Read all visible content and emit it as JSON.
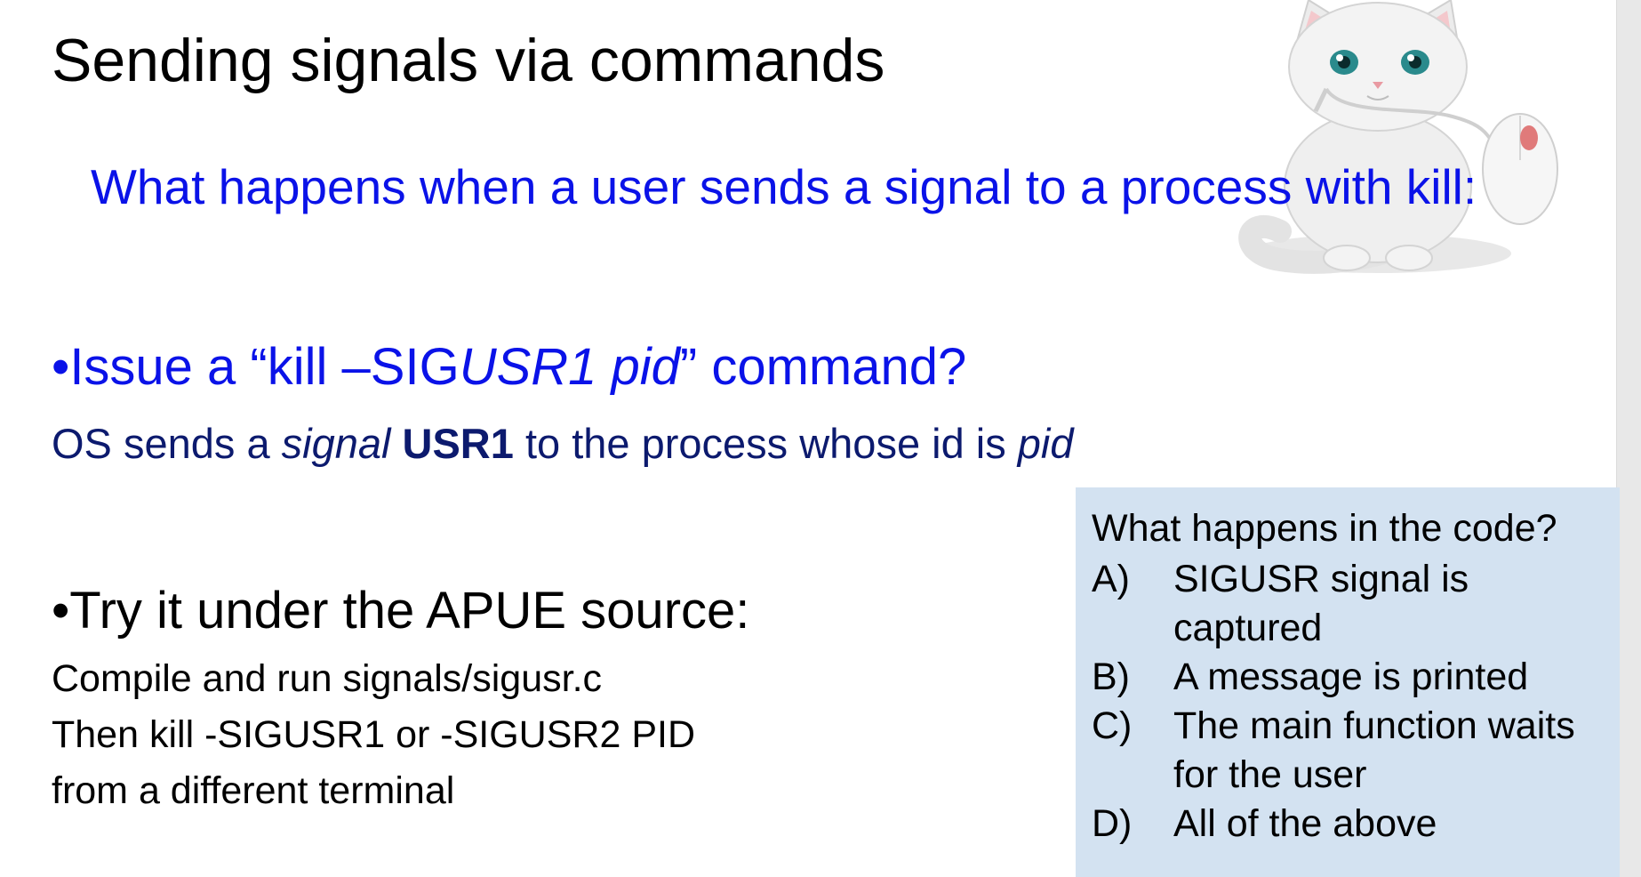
{
  "slide": {
    "title": "Sending signals via commands",
    "question": "What happens when a user sends a signal to a process with kill:",
    "bullet1": {
      "marker": "•",
      "prefix": "Issue a “kill –SIG",
      "italic": "USR1 pid",
      "suffix": "” command?"
    },
    "os_line": {
      "part1": "OS sends a ",
      "italic1": "signal",
      "bold": "USR1",
      "part2": " to the process whose id is ",
      "italic2": "pid"
    },
    "bullet2": "•Try it under the APUE source:",
    "instructions": [
      "Compile and run signals/sigusr.c",
      "Then kill -SIGUSR1 or -SIGUSR2 PID",
      "from a different terminal"
    ],
    "quiz": {
      "question": "What happens in the code?",
      "options": [
        {
          "letter": "A)",
          "text": "SIGUSR signal is captured"
        },
        {
          "letter": "B)",
          "text": "A message is printed"
        },
        {
          "letter": "C)",
          "text": "The main function waits for the user"
        },
        {
          "letter": "D)",
          "text": "All of the above"
        }
      ]
    }
  },
  "colors": {
    "accent_blue": "#0a12e8",
    "navy_text": "#0c1a6e",
    "quiz_background": "#d3e2f1"
  },
  "icons": {
    "mascot": "white-cat-with-computer-mouse-icon"
  }
}
